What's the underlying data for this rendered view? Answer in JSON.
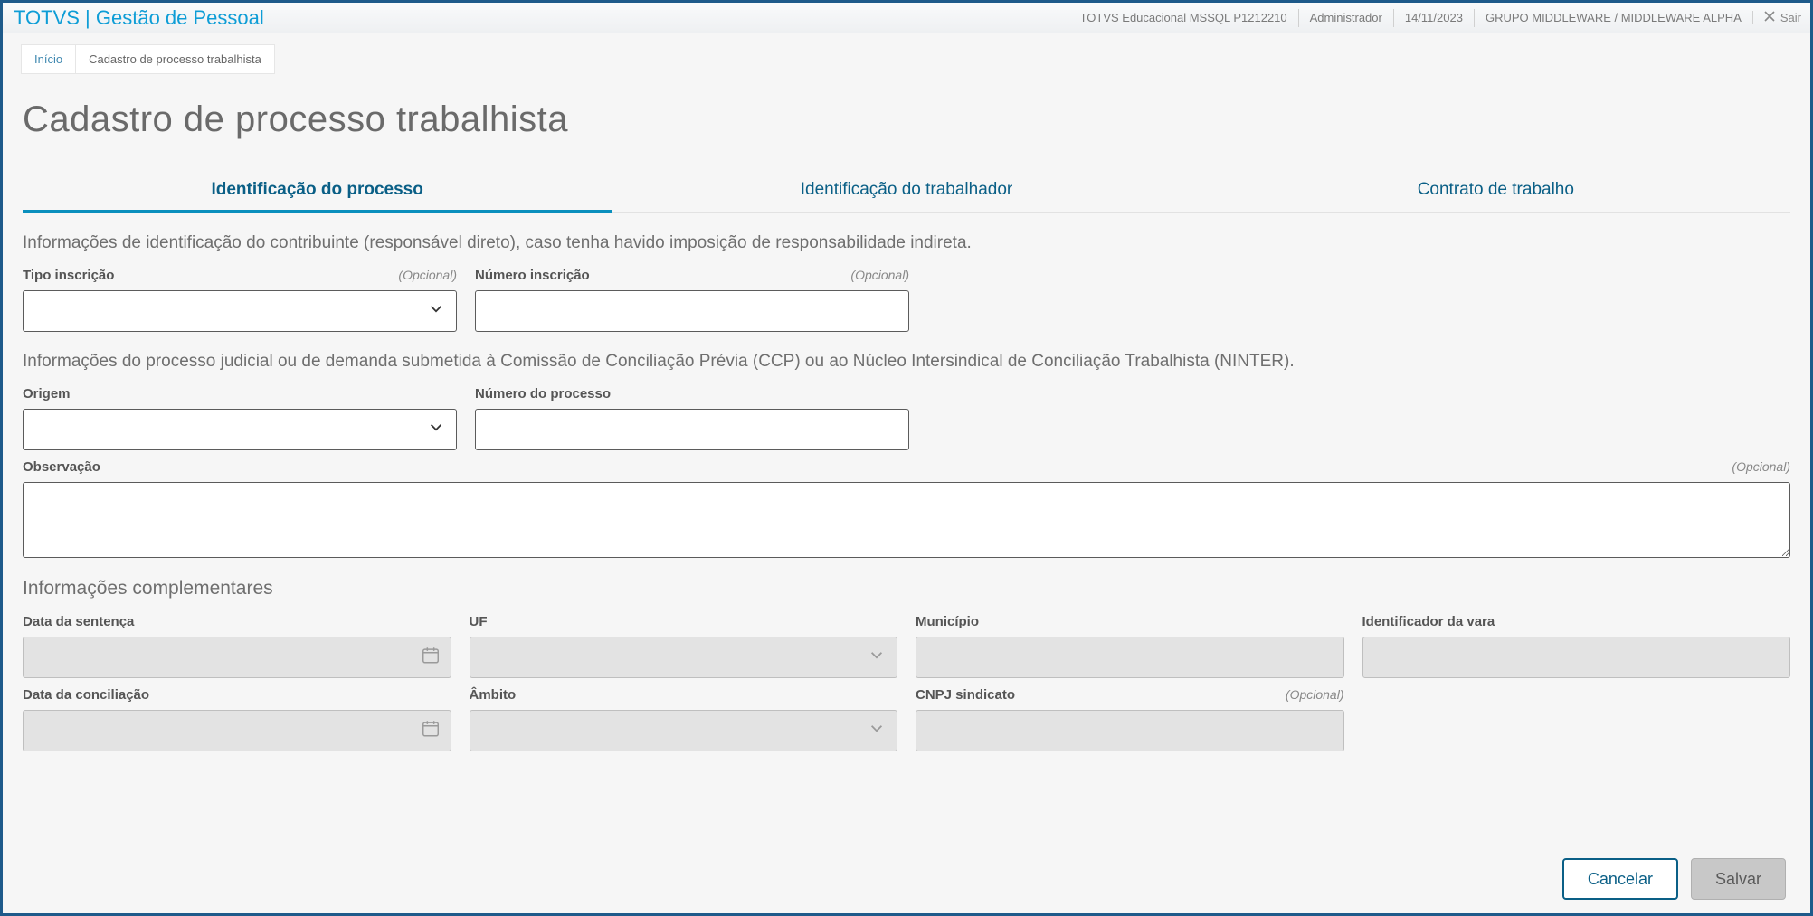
{
  "topbar": {
    "brand": "TOTVS | Gestão de Pessoal",
    "env": "TOTVS Educacional MSSQL P1212210",
    "user": "Administrador",
    "date": "14/11/2023",
    "group": "GRUPO MIDDLEWARE / MIDDLEWARE ALPHA",
    "exit": "Sair"
  },
  "breadcrumb": {
    "home": "Início",
    "current": "Cadastro de processo trabalhista"
  },
  "page": {
    "title": "Cadastro de processo trabalhista"
  },
  "tabs": {
    "t1": "Identificação do processo",
    "t2": "Identificação do trabalhador",
    "t3": "Contrato de trabalho"
  },
  "texts": {
    "sec1": "Informações de identificação do contribuinte (responsável direto), caso tenha havido imposição de responsabilidade indireta.",
    "sec2": "Informações do processo judicial ou de demanda submetida à Comissão de Conciliação Prévia (CCP) ou ao Núcleo Intersindical de Conciliação Trabalhista (NINTER).",
    "compl": "Informações complementares",
    "optional": "(Opcional)"
  },
  "labels": {
    "tipo_inscricao": "Tipo inscrição",
    "numero_inscricao": "Número inscrição",
    "origem": "Origem",
    "numero_processo": "Número do processo",
    "observacao": "Observação",
    "data_sentenca": "Data da sentença",
    "uf": "UF",
    "municipio": "Município",
    "id_vara": "Identificador da vara",
    "data_conciliacao": "Data da conciliação",
    "ambito": "Âmbito",
    "cnpj_sindicato": "CNPJ sindicato"
  },
  "values": {
    "tipo_inscricao": "",
    "numero_inscricao": "",
    "origem": "",
    "numero_processo": "",
    "observacao": "",
    "data_sentenca": "",
    "uf": "",
    "municipio": "",
    "id_vara": "",
    "data_conciliacao": "",
    "ambito": "",
    "cnpj_sindicato": ""
  },
  "buttons": {
    "cancel": "Cancelar",
    "save": "Salvar"
  }
}
